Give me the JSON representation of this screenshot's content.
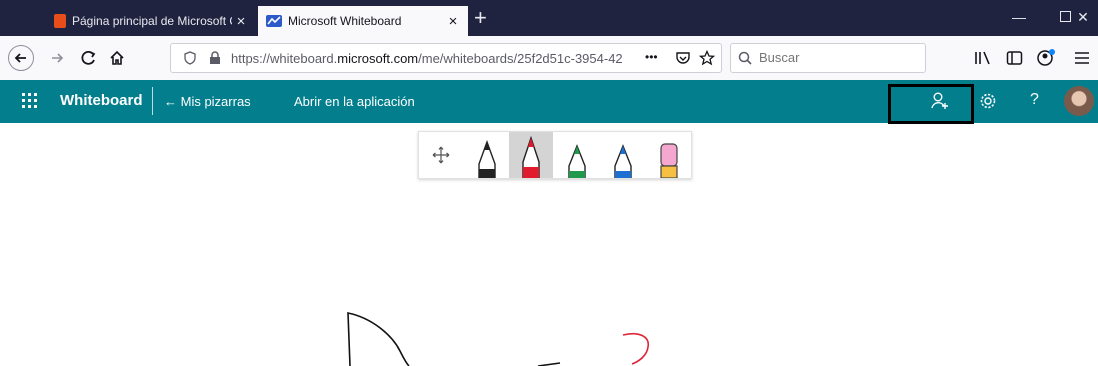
{
  "tabs": [
    {
      "label": "Página principal de Microsoft Office",
      "icon": "office-icon"
    },
    {
      "label": "Microsoft Whiteboard",
      "icon": "whiteboard-icon"
    }
  ],
  "tab_close_glyph": "×",
  "new_tab_glyph": "+",
  "window_controls": {
    "minimize": "—",
    "maximize": "☐",
    "close": "✕"
  },
  "nav": {
    "back": "back-arrow-icon",
    "forward": "forward-arrow-icon",
    "reload": "reload-icon",
    "home": "home-icon"
  },
  "url": {
    "prefix": "https://whiteboard.",
    "domain": "microsoft.com",
    "path": "/me/whiteboards/25f2d51c-3954-42",
    "more": "•••"
  },
  "search": {
    "placeholder": "Buscar"
  },
  "app": {
    "title": "Whiteboard",
    "back_link": "← Mis pizarras",
    "open_app": "Abrir en la aplicación",
    "help": "?"
  },
  "toolbar": {
    "tools": [
      {
        "name": "move-tool",
        "color": "#555555"
      },
      {
        "name": "pen-black",
        "color": "#222222"
      },
      {
        "name": "pen-red",
        "color": "#e01b2e",
        "selected": true
      },
      {
        "name": "pen-green",
        "color": "#1f9a4c"
      },
      {
        "name": "pen-blue",
        "color": "#1f6fd0"
      },
      {
        "name": "eraser",
        "color": "#f5a8cf"
      }
    ]
  },
  "colors": {
    "tabbar": "#202340",
    "appbar": "#037e8d",
    "canvas": "#ffffff"
  }
}
